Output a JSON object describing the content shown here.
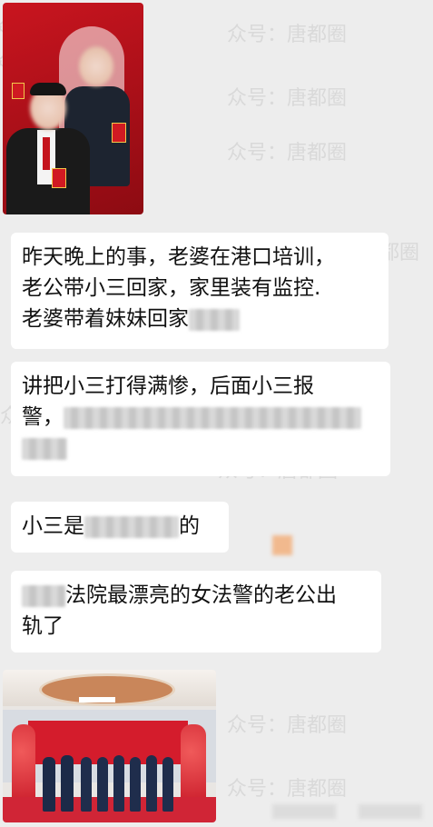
{
  "watermark": {
    "text": "众号：唐都圈"
  },
  "messages": [
    {
      "kind": "image",
      "desc": "wedding-photo"
    },
    {
      "kind": "text",
      "line1": "昨天晚上的事，老婆在港口培训，",
      "line2": "老公带小三回家，家里装有监控.",
      "line3": "老婆带着妹妹回家"
    },
    {
      "kind": "text",
      "line1": "讲把小三打得满惨，后面小三报",
      "line2": "警，"
    },
    {
      "kind": "text",
      "part1": "小三是",
      "part2": "的"
    },
    {
      "kind": "text",
      "line1": "法院最漂亮的女法警的老公出",
      "line2": "轨了"
    },
    {
      "kind": "image",
      "desc": "group-photo"
    }
  ],
  "colors": {
    "background": "#ededed",
    "bubble": "#ffffff",
    "accent_red": "#b3101a"
  }
}
